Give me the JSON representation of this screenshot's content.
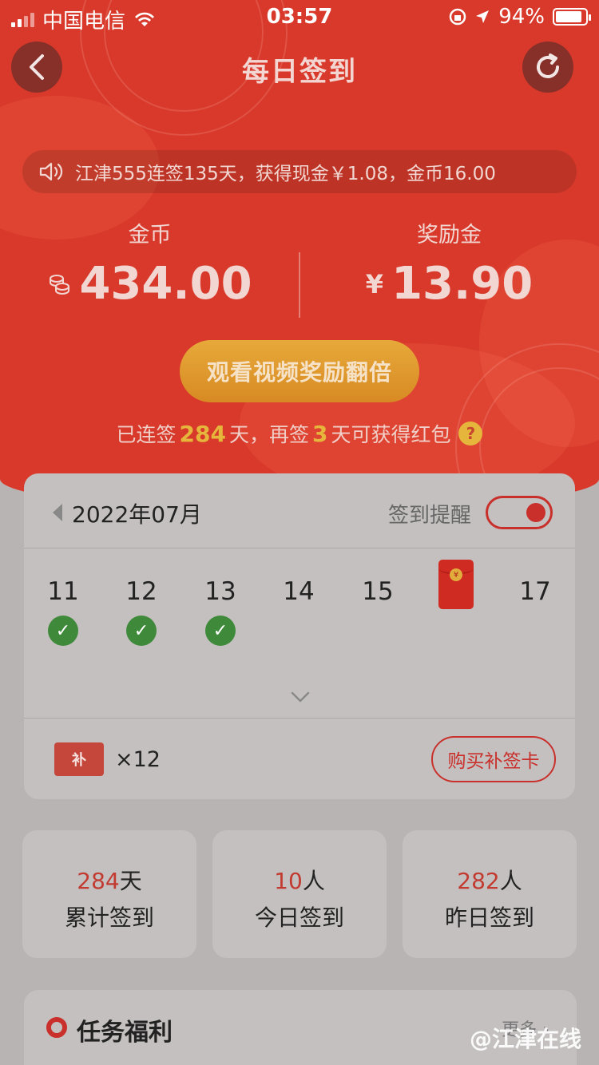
{
  "status_bar": {
    "carrier": "中国电信",
    "time": "03:57",
    "battery": "94%"
  },
  "header": {
    "title": "每日签到"
  },
  "notice": {
    "text": "江津555连签135天，获得现金￥1.08，金币16.00"
  },
  "coins": {
    "label": "金币",
    "value": "434.00"
  },
  "reward": {
    "label": "奖励金",
    "prefix": "¥",
    "value": "13.90"
  },
  "watch_button": {
    "label": "观看视频奖励翻倍"
  },
  "streak": {
    "prefix": "已连签",
    "days": "284",
    "mid": "天，再签",
    "remaining": "3",
    "suffix": "天可获得红包",
    "help": "?"
  },
  "calendar": {
    "month": "2022年07月",
    "reminder_label": "签到提醒",
    "reminder_on": true,
    "days": [
      {
        "num": "11",
        "checked": true
      },
      {
        "num": "12",
        "checked": true
      },
      {
        "num": "13",
        "checked": true
      },
      {
        "num": "14",
        "checked": false
      },
      {
        "num": "15",
        "checked": false
      },
      {
        "num": "",
        "red_packet": true
      },
      {
        "num": "17",
        "checked": false
      }
    ]
  },
  "makeup": {
    "ticket_text": "补",
    "count": "×12",
    "buy_label": "购买补签卡"
  },
  "summary": [
    {
      "num": "284",
      "unit": "天",
      "label": "累计签到"
    },
    {
      "num": "10",
      "unit": "人",
      "label": "今日签到"
    },
    {
      "num": "282",
      "unit": "人",
      "label": "昨日签到"
    }
  ],
  "tasks": {
    "title": "任务福利",
    "more": "更多"
  },
  "watermark": "@江津在线",
  "colors": {
    "hero": "#d8392a",
    "accent": "#c9302b",
    "gold": "#e6b63c",
    "check": "#3f8a3a"
  }
}
